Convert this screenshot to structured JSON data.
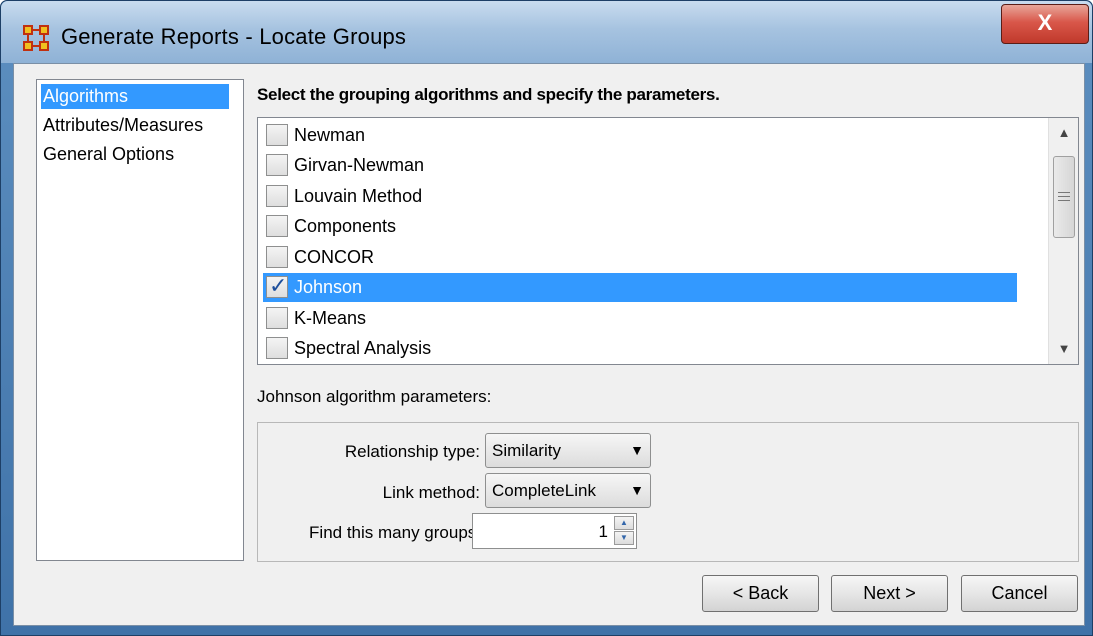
{
  "window": {
    "title": "Generate Reports - Locate Groups",
    "close_label": "X"
  },
  "sidebar": {
    "items": [
      {
        "label": "Algorithms",
        "selected": true
      },
      {
        "label": "Attributes/Measures",
        "selected": false
      },
      {
        "label": "General Options",
        "selected": false
      }
    ]
  },
  "main": {
    "heading": "Select the grouping algorithms and specify the parameters.",
    "algorithms": [
      {
        "label": "Newman",
        "checked": false
      },
      {
        "label": "Girvan-Newman",
        "checked": false
      },
      {
        "label": "Louvain Method",
        "checked": false
      },
      {
        "label": "Components",
        "checked": false
      },
      {
        "label": "CONCOR",
        "checked": false
      },
      {
        "label": "Johnson",
        "checked": true,
        "selected": true
      },
      {
        "label": "K-Means",
        "checked": false
      },
      {
        "label": "Spectral Analysis",
        "checked": false
      }
    ],
    "params_label": "Johnson algorithm parameters:",
    "params": {
      "relationship_type_label": "Relationship type:",
      "relationship_type_value": "Similarity",
      "link_method_label": "Link method:",
      "link_method_value": "CompleteLink",
      "groups_label": "Find this many groups:",
      "groups_value": "1"
    }
  },
  "footer": {
    "back_label": "< Back",
    "next_label": "Next >",
    "cancel_label": "Cancel"
  },
  "colors": {
    "selection": "#3399ff",
    "title_bar": "#a6c3e0",
    "close_button": "#c0392b"
  },
  "icons": [
    "app-network-icon",
    "close-icon",
    "checkmark-icon",
    "scroll-up-icon",
    "scroll-down-icon",
    "dropdown-arrow-icon",
    "spin-up-icon",
    "spin-down-icon"
  ]
}
